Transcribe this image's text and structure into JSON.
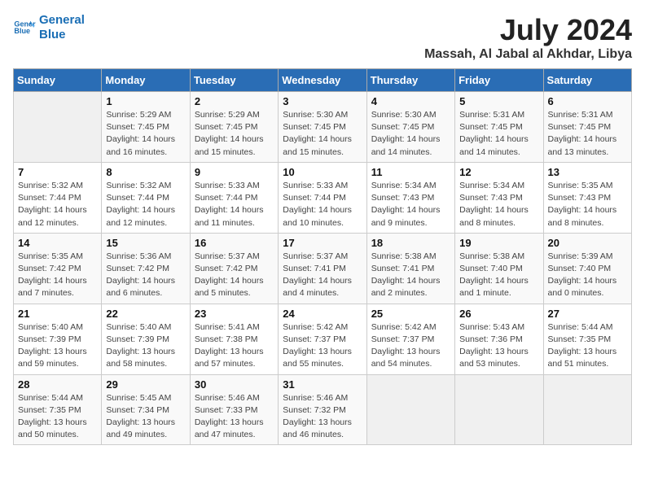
{
  "logo": {
    "line1": "General",
    "line2": "Blue"
  },
  "title": "July 2024",
  "subtitle": "Massah, Al Jabal al Akhdar, Libya",
  "days_of_week": [
    "Sunday",
    "Monday",
    "Tuesday",
    "Wednesday",
    "Thursday",
    "Friday",
    "Saturday"
  ],
  "weeks": [
    [
      {
        "day": "",
        "info": ""
      },
      {
        "day": "1",
        "info": "Sunrise: 5:29 AM\nSunset: 7:45 PM\nDaylight: 14 hours\nand 16 minutes."
      },
      {
        "day": "2",
        "info": "Sunrise: 5:29 AM\nSunset: 7:45 PM\nDaylight: 14 hours\nand 15 minutes."
      },
      {
        "day": "3",
        "info": "Sunrise: 5:30 AM\nSunset: 7:45 PM\nDaylight: 14 hours\nand 15 minutes."
      },
      {
        "day": "4",
        "info": "Sunrise: 5:30 AM\nSunset: 7:45 PM\nDaylight: 14 hours\nand 14 minutes."
      },
      {
        "day": "5",
        "info": "Sunrise: 5:31 AM\nSunset: 7:45 PM\nDaylight: 14 hours\nand 14 minutes."
      },
      {
        "day": "6",
        "info": "Sunrise: 5:31 AM\nSunset: 7:45 PM\nDaylight: 14 hours\nand 13 minutes."
      }
    ],
    [
      {
        "day": "7",
        "info": "Sunrise: 5:32 AM\nSunset: 7:44 PM\nDaylight: 14 hours\nand 12 minutes."
      },
      {
        "day": "8",
        "info": "Sunrise: 5:32 AM\nSunset: 7:44 PM\nDaylight: 14 hours\nand 12 minutes."
      },
      {
        "day": "9",
        "info": "Sunrise: 5:33 AM\nSunset: 7:44 PM\nDaylight: 14 hours\nand 11 minutes."
      },
      {
        "day": "10",
        "info": "Sunrise: 5:33 AM\nSunset: 7:44 PM\nDaylight: 14 hours\nand 10 minutes."
      },
      {
        "day": "11",
        "info": "Sunrise: 5:34 AM\nSunset: 7:43 PM\nDaylight: 14 hours\nand 9 minutes."
      },
      {
        "day": "12",
        "info": "Sunrise: 5:34 AM\nSunset: 7:43 PM\nDaylight: 14 hours\nand 8 minutes."
      },
      {
        "day": "13",
        "info": "Sunrise: 5:35 AM\nSunset: 7:43 PM\nDaylight: 14 hours\nand 8 minutes."
      }
    ],
    [
      {
        "day": "14",
        "info": "Sunrise: 5:35 AM\nSunset: 7:42 PM\nDaylight: 14 hours\nand 7 minutes."
      },
      {
        "day": "15",
        "info": "Sunrise: 5:36 AM\nSunset: 7:42 PM\nDaylight: 14 hours\nand 6 minutes."
      },
      {
        "day": "16",
        "info": "Sunrise: 5:37 AM\nSunset: 7:42 PM\nDaylight: 14 hours\nand 5 minutes."
      },
      {
        "day": "17",
        "info": "Sunrise: 5:37 AM\nSunset: 7:41 PM\nDaylight: 14 hours\nand 4 minutes."
      },
      {
        "day": "18",
        "info": "Sunrise: 5:38 AM\nSunset: 7:41 PM\nDaylight: 14 hours\nand 2 minutes."
      },
      {
        "day": "19",
        "info": "Sunrise: 5:38 AM\nSunset: 7:40 PM\nDaylight: 14 hours\nand 1 minute."
      },
      {
        "day": "20",
        "info": "Sunrise: 5:39 AM\nSunset: 7:40 PM\nDaylight: 14 hours\nand 0 minutes."
      }
    ],
    [
      {
        "day": "21",
        "info": "Sunrise: 5:40 AM\nSunset: 7:39 PM\nDaylight: 13 hours\nand 59 minutes."
      },
      {
        "day": "22",
        "info": "Sunrise: 5:40 AM\nSunset: 7:39 PM\nDaylight: 13 hours\nand 58 minutes."
      },
      {
        "day": "23",
        "info": "Sunrise: 5:41 AM\nSunset: 7:38 PM\nDaylight: 13 hours\nand 57 minutes."
      },
      {
        "day": "24",
        "info": "Sunrise: 5:42 AM\nSunset: 7:37 PM\nDaylight: 13 hours\nand 55 minutes."
      },
      {
        "day": "25",
        "info": "Sunrise: 5:42 AM\nSunset: 7:37 PM\nDaylight: 13 hours\nand 54 minutes."
      },
      {
        "day": "26",
        "info": "Sunrise: 5:43 AM\nSunset: 7:36 PM\nDaylight: 13 hours\nand 53 minutes."
      },
      {
        "day": "27",
        "info": "Sunrise: 5:44 AM\nSunset: 7:35 PM\nDaylight: 13 hours\nand 51 minutes."
      }
    ],
    [
      {
        "day": "28",
        "info": "Sunrise: 5:44 AM\nSunset: 7:35 PM\nDaylight: 13 hours\nand 50 minutes."
      },
      {
        "day": "29",
        "info": "Sunrise: 5:45 AM\nSunset: 7:34 PM\nDaylight: 13 hours\nand 49 minutes."
      },
      {
        "day": "30",
        "info": "Sunrise: 5:46 AM\nSunset: 7:33 PM\nDaylight: 13 hours\nand 47 minutes."
      },
      {
        "day": "31",
        "info": "Sunrise: 5:46 AM\nSunset: 7:32 PM\nDaylight: 13 hours\nand 46 minutes."
      },
      {
        "day": "",
        "info": ""
      },
      {
        "day": "",
        "info": ""
      },
      {
        "day": "",
        "info": ""
      }
    ]
  ]
}
